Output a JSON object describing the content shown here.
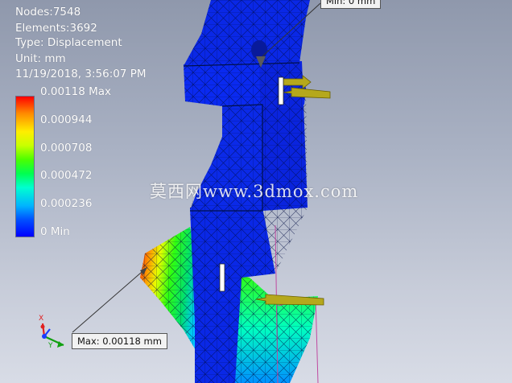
{
  "info": {
    "nodes": "Nodes:7548",
    "elements": "Elements:3692",
    "type": "Type: Displacement",
    "unit": "Unit: mm",
    "timestamp": "11/19/2018, 3:56:07 PM"
  },
  "legend": {
    "labels": [
      "0.00118 Max",
      "0.000944",
      "0.000708",
      "0.000472",
      "0.000236",
      "0 Min"
    ]
  },
  "probes": {
    "min_label": "Min: 0 mm",
    "max_label": "Max: 0.00118 mm"
  },
  "triad": {
    "x_axis": "X",
    "y_axis": "Y"
  },
  "watermark": "莫西网www.3dmox.com",
  "colors": {
    "mesh_blue": "#0a28e6",
    "load_arrow": "#b5a81c",
    "triad_x": "#e02020",
    "triad_y": "#10a010",
    "triad_z": "#1a3cff"
  }
}
